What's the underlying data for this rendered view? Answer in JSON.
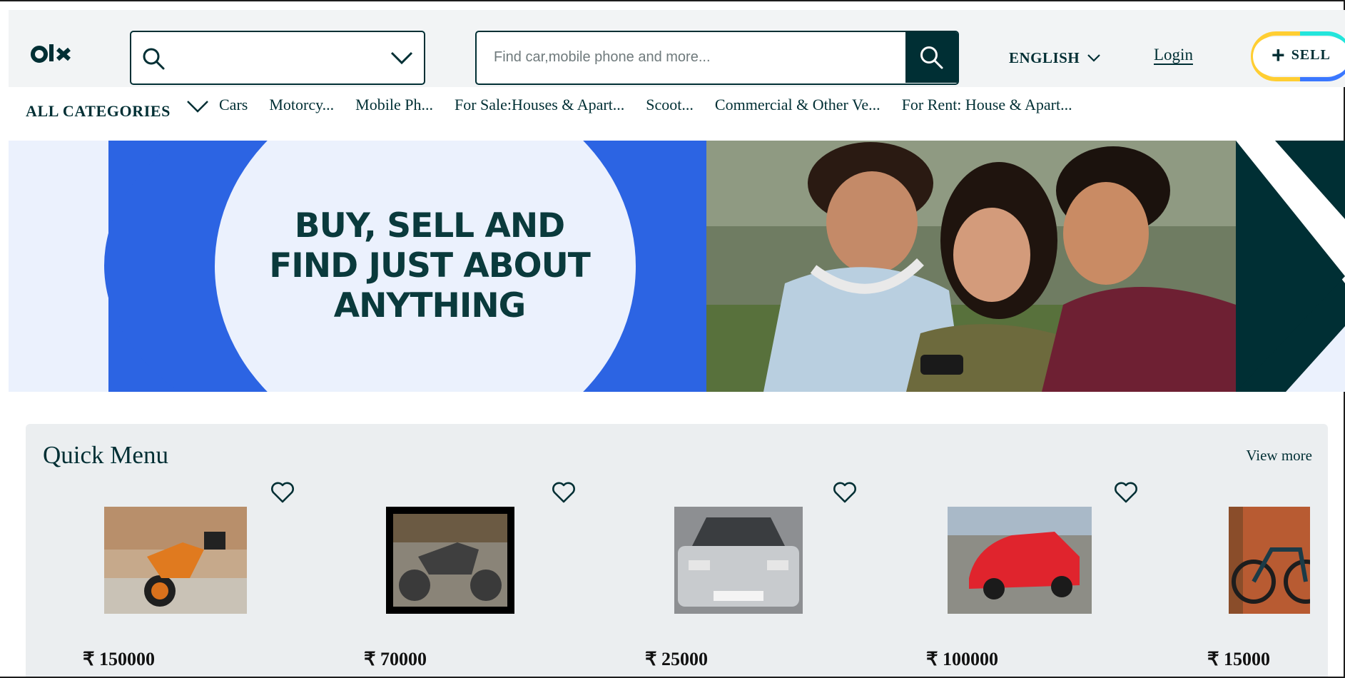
{
  "header": {
    "logo_text": "OLX",
    "location_placeholder": "",
    "search_placeholder": "Find car,mobile phone and more...",
    "language": "ENGLISH",
    "login": "Login",
    "sell": "SELL",
    "sell_ring_colors": [
      "#ffce32",
      "#23e5db",
      "#3a77ff"
    ]
  },
  "categories": {
    "all_label": "ALL CATEGORIES",
    "items": [
      "Cars",
      "Motorcy...",
      "Mobile Ph...",
      "For Sale:Houses & Apart...",
      "Scoot...",
      "Commercial & Other Ve...",
      "For Rent: House & Apart..."
    ]
  },
  "banner": {
    "line1": "BUY, SELL AND",
    "line2": "FIND JUST ABOUT",
    "line3": "ANYTHING",
    "colors": {
      "blue": "#2c64e3",
      "pale": "#ebf1fd",
      "dark": "#002f34"
    }
  },
  "quick_menu": {
    "title": "Quick Menu",
    "view_more": "View more",
    "items": [
      {
        "image": "motorcycle-photo",
        "price": "₹ 150000"
      },
      {
        "image": "motorcycle-photo",
        "price": "₹ 70000"
      },
      {
        "image": "car-photo",
        "price": "₹ 25000"
      },
      {
        "image": "car-photo",
        "price": "₹ 100000"
      },
      {
        "image": "bicycle-photo",
        "price": "₹ 15000"
      }
    ]
  },
  "colors": {
    "brand_dark": "#002f34",
    "header_bg": "#f2f4f5",
    "section_bg": "#ebeef0"
  }
}
